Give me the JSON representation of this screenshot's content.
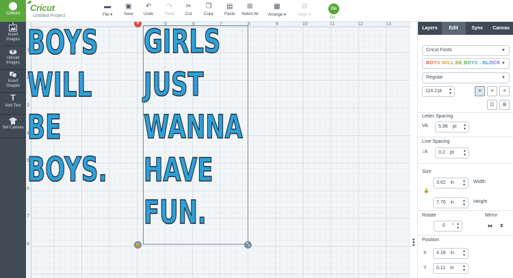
{
  "sidebar": {
    "user_name": "Colleen",
    "items": [
      {
        "label_1": "Insert",
        "label_2": "Images"
      },
      {
        "label_1": "Upload",
        "label_2": "Images"
      },
      {
        "label_1": "Insert",
        "label_2": "Shapes"
      },
      {
        "label_1": "Add Text",
        "label_2": ""
      },
      {
        "label_1": "Set Canvas",
        "label_2": ""
      }
    ]
  },
  "header": {
    "brand": "Cricut",
    "project_name": "Untitled Project",
    "toolbar": {
      "file": "File",
      "save": "Save",
      "undo": "Undo",
      "redo": "Redo",
      "cut": "Cut",
      "copy": "Copy",
      "paste": "Paste",
      "select_all": "Select All",
      "arrange": "Arrange",
      "align": "Align",
      "go": "Go",
      "go_label": "Go"
    }
  },
  "canvas": {
    "ruler_top": [
      "4",
      "5",
      "6",
      "7",
      "8",
      "9",
      "10",
      "11",
      "12",
      "13"
    ],
    "ruler_left": [
      "1",
      "2",
      "3",
      "4",
      "5",
      "6",
      "7",
      "8"
    ],
    "text_boys": [
      "BOYS",
      "WILL",
      "BE",
      "BOYS."
    ],
    "text_girls": [
      "GIRLS",
      "JUST",
      "WANNA",
      "HAVE",
      "FUN."
    ]
  },
  "panel": {
    "tabs": [
      "Layers",
      "Edit",
      "Sync",
      "Canvas"
    ],
    "active_tab": "Edit",
    "font_source": "Cricut Fonts",
    "font_name": "BOYS WILL BE BOYS - BLOCK",
    "font_style": "Regular",
    "font_size": "114.2",
    "font_size_unit": "pt",
    "letter_spacing_label": "Letter Spacing",
    "letter_spacing_value": "5.96",
    "letter_spacing_unit": "pt",
    "line_spacing_label": "Line Spacing",
    "line_spacing_value": "0.2",
    "line_spacing_unit": "pt",
    "size_label": "Size",
    "width_value": "3.62",
    "width_unit": "in",
    "width_label": "Width",
    "height_value": "7.76",
    "height_unit": "in",
    "height_label": "Height",
    "rotate_label": "Rotate",
    "rotate_value": "0",
    "rotate_unit": "°",
    "mirror_label": "Mirror",
    "position_label": "Position",
    "x_label": "X",
    "x_value": "4.18",
    "x_unit": "in",
    "y_label": "Y",
    "y_value": "0.11",
    "y_unit": "in"
  },
  "colors": {
    "brand_green": "#5aa83c",
    "sidebar_bg": "#3f4a55",
    "text_fill": "#2fa0d8",
    "text_outline": "#21303d"
  }
}
